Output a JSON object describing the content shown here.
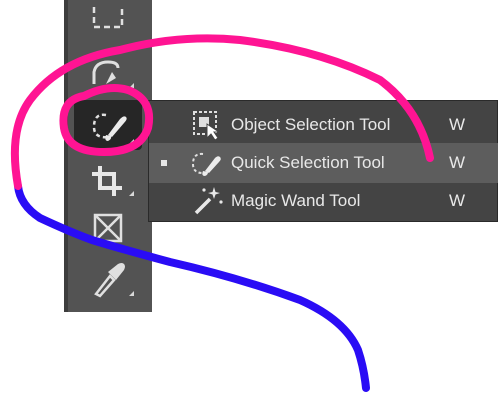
{
  "toolbar": {
    "tools": [
      {
        "name": "rectangular-marquee-tool",
        "icon": "marquee-icon"
      },
      {
        "name": "lasso-tool",
        "icon": "lasso-icon"
      },
      {
        "name": "quick-selection-tool",
        "icon": "quick-selection-icon",
        "active": true
      },
      {
        "name": "crop-tool",
        "icon": "crop-icon"
      },
      {
        "name": "frame-tool",
        "icon": "frame-icon"
      },
      {
        "name": "eyedropper-tool",
        "icon": "eyedropper-icon"
      }
    ]
  },
  "flyout": {
    "items": [
      {
        "label": "Object Selection Tool",
        "shortcut": "W",
        "icon": "object-selection-icon",
        "selected": false
      },
      {
        "label": "Quick Selection Tool",
        "shortcut": "W",
        "icon": "quick-selection-icon",
        "selected": true
      },
      {
        "label": "Magic Wand Tool",
        "shortcut": "W",
        "icon": "magic-wand-icon",
        "selected": false
      }
    ]
  },
  "colors": {
    "toolbar_bg": "#535353",
    "flyout_bg": "#444444",
    "selected_row_bg": "#5d5d5d",
    "annotation_pink": "#ff1493",
    "annotation_blue": "#2a0cf5"
  }
}
